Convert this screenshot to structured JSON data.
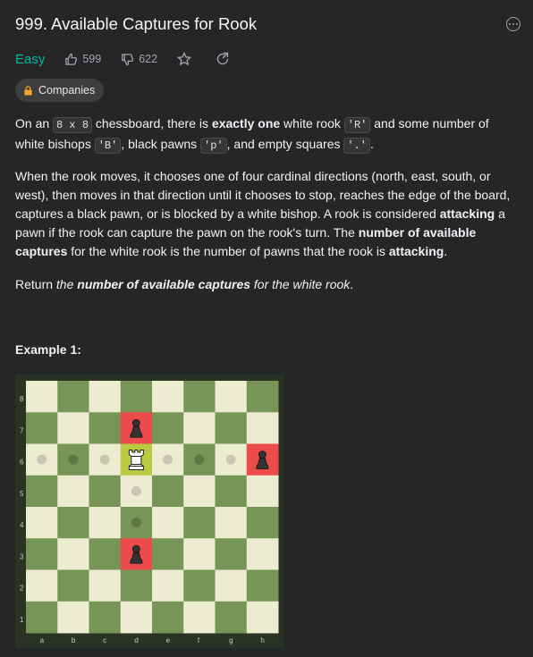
{
  "problem": {
    "title": "999. Available Captures for Rook",
    "difficulty": "Easy",
    "likes": "599",
    "dislikes": "622",
    "companies_label": "Companies"
  },
  "description": {
    "p1": {
      "t1": "On an ",
      "c1": "8 x 8",
      "t2": " chessboard, there is ",
      "b1": "exactly one",
      "t3": " white rook ",
      "c2": "'R'",
      "t4": " and some number of white bishops ",
      "c3": "'B'",
      "t5": ", black pawns ",
      "c4": "'p'",
      "t6": ", and empty squares ",
      "c5": "'.'",
      "t7": "."
    },
    "p2": {
      "t1": "When the rook moves, it chooses one of four cardinal directions (north, east, south, or west), then moves in that direction until it chooses to stop, reaches the edge of the board, captures a black pawn, or is blocked by a white bishop. A rook is considered ",
      "b1": "attacking",
      "t2": " a pawn if the rook can capture the pawn on the rook's turn. The ",
      "b2": "number of available captures",
      "t3": " for the white rook is the number of pawns that the rook is ",
      "b3": "attacking",
      "t4": "."
    },
    "p3": {
      "t1": "Return ",
      "i1": "the ",
      "bi": "number of available captures",
      "i2": " for the white rook",
      "t2": "."
    }
  },
  "example": {
    "title": "Example 1:",
    "board": {
      "files": [
        "a",
        "b",
        "c",
        "d",
        "e",
        "f",
        "g",
        "h"
      ],
      "ranks": [
        "8",
        "7",
        "6",
        "5",
        "4",
        "3",
        "2",
        "1"
      ],
      "rook": "d6",
      "pawns": [
        "d7",
        "h6",
        "d3"
      ],
      "captured_highlight": [
        "d7",
        "h6",
        "d3"
      ],
      "move_dots": [
        "a6",
        "b6",
        "c6",
        "e6",
        "f6",
        "g6",
        "d5",
        "d4"
      ],
      "colors": {
        "light": "#ebecd0",
        "dark": "#779556",
        "capture": "#eb4c4b",
        "rook_square": "#b9ca43",
        "dot_on_light": "#c7c8b3",
        "dot_on_dark": "#5f7745"
      }
    }
  },
  "icons": [
    "thumbs-up-icon",
    "thumbs-down-icon",
    "star-icon",
    "share-icon",
    "more-icon",
    "lock-icon",
    "black-pawn-icon",
    "white-rook-icon"
  ]
}
